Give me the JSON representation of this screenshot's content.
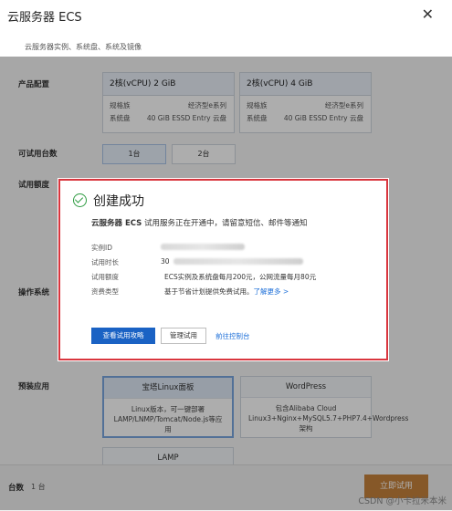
{
  "title": "云服务器 ECS",
  "subtitle": "云服务器实例、系统盘、系统及镜像",
  "labels": {
    "config": "产品配置",
    "count": "可试用台数",
    "quota": "试用额度",
    "os": "操作系统",
    "preinstall": "预装应用"
  },
  "configs": [
    {
      "head": "2核(vCPU) 2 GiB",
      "family_label": "规格族",
      "family": "经济型e系列",
      "disk_label": "系统盘",
      "disk": "40 GiB ESSD Entry 云盘"
    },
    {
      "head": "2核(vCPU) 4 GiB",
      "family_label": "规格族",
      "family": "经济型e系列",
      "disk_label": "系统盘",
      "disk": "40 GiB ESSD Entry 云盘"
    }
  ],
  "count_options": [
    "1台",
    "2台"
  ],
  "apps": [
    {
      "head": "宝塔Linux面板",
      "body": "Linux版本，可一键部署LAMP/LNMP/Tomcat/Node.js等应用"
    },
    {
      "head": "WordPress",
      "body": "包含Alibaba Cloud Linux3+Nginx+MySQL5.7+PHP7.4+Wordpress架构"
    },
    {
      "head": "LAMP"
    }
  ],
  "footer": {
    "count_label": "台数",
    "count_value": "1 台",
    "submit": "立即试用"
  },
  "watermark": "CSDN @小卡拉米本米",
  "modal": {
    "title": "创建成功",
    "desc_bold": "云服务器 ECS",
    "desc_rest": " 试用服务正在开通中，请留意短信、邮件等通知",
    "rows": [
      {
        "k": "实例ID"
      },
      {
        "k": "试用时长",
        "v": "30"
      },
      {
        "k": "试用额度",
        "v": "ECS实例及系统盘每月200元，公网流量每月80元"
      },
      {
        "k": "资费类型",
        "v": "基于节省计划提供免费试用。",
        "link": "了解更多 >"
      }
    ],
    "btn_primary": "查看试用攻略",
    "btn_manage": "管理试用",
    "btn_console": "前往控制台"
  },
  "colors": {
    "primary": "#1a62c4",
    "success": "#2d9b41",
    "highlight_border": "#d9363e",
    "submit": "#c6823b"
  }
}
